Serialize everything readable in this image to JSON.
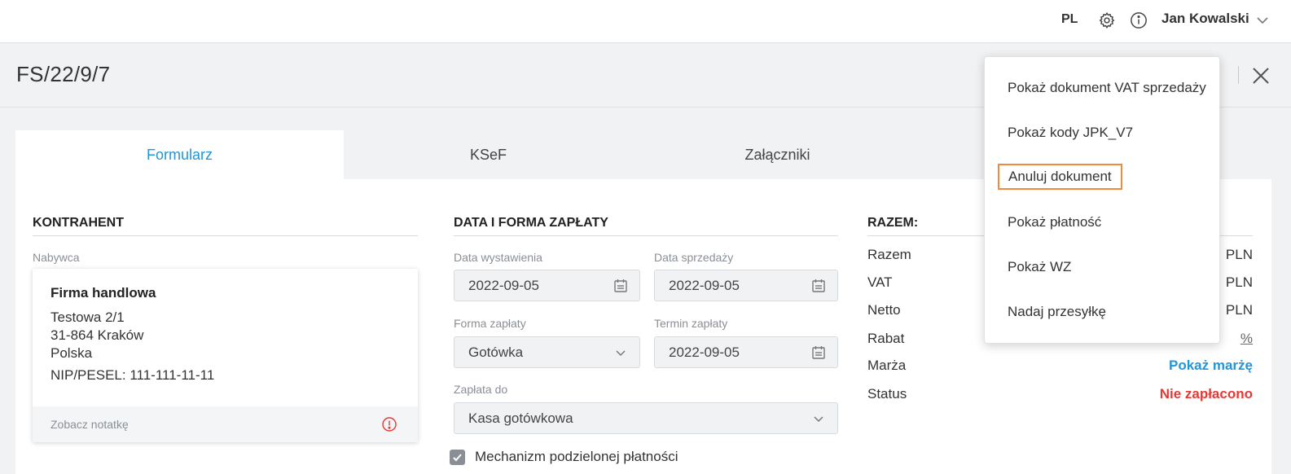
{
  "topbar": {
    "language": "PL",
    "user_name": "Jan Kowalski",
    "icons": [
      "gear-icon",
      "info-icon",
      "chevron-down-icon"
    ]
  },
  "header": {
    "document_title": "FS/22/9/7"
  },
  "tabs": [
    {
      "label": "Formularz",
      "active": true
    },
    {
      "label": "KSeF",
      "active": false
    },
    {
      "label": "Załączniki",
      "active": false
    }
  ],
  "contractor": {
    "section_title": "KONTRAHENT",
    "buyer_label": "Nabywca",
    "name": "Firma handlowa",
    "street": "Testowa 2/1",
    "city": "31-864 Kraków",
    "country": "Polska",
    "nip": "NIP/PESEL: 111-111-11-11",
    "note_link": "Zobacz notatkę"
  },
  "payment": {
    "section_title": "DATA I FORMA ZAPŁATY",
    "issue_date_label": "Data wystawienia",
    "issue_date": "2022-09-05",
    "sale_date_label": "Data sprzedaży",
    "sale_date": "2022-09-05",
    "method_label": "Forma zapłaty",
    "method": "Gotówka",
    "due_label": "Termin zapłaty",
    "due_date": "2022-09-05",
    "account_label": "Zapłata do",
    "account": "Kasa gotówkowa",
    "split_payment_label": "Mechanizm podzielonej płatności",
    "split_payment_checked": true
  },
  "summary": {
    "section_title": "RAZEM:",
    "rows": [
      {
        "label": "Razem",
        "value": "PLN"
      },
      {
        "label": "VAT",
        "value": "PLN"
      },
      {
        "label": "Netto",
        "value": "PLN"
      },
      {
        "label": "Rabat",
        "value": "%"
      },
      {
        "label": "Marża",
        "value": "Pokaż marżę"
      },
      {
        "label": "Status",
        "value": "Nie zapłacono"
      }
    ],
    "status_color": "#e53935",
    "link_color": "#2196d9"
  },
  "menu": {
    "items": [
      "Pokaż dokument VAT sprzedaży",
      "Pokaż kody JPK_V7",
      "Anuluj dokument",
      "Pokaż płatność",
      "Pokaż WZ",
      "Nadaj przesyłkę"
    ],
    "highlight_color": "#f08a3c"
  }
}
